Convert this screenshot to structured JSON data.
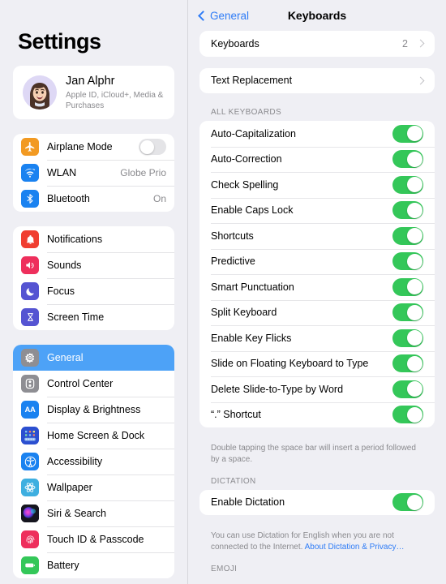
{
  "sidebar": {
    "title": "Settings",
    "account": {
      "name": "Jan Alphr",
      "subtitle": "Apple ID, iCloud+, Media & Purchases",
      "avatar_icon": "memoji-avatar"
    },
    "group1": [
      {
        "label": "Airplane Mode",
        "icon": "airplane-icon",
        "color": "#f29a22",
        "control": "toggle-off"
      },
      {
        "label": "WLAN",
        "icon": "wifi-icon",
        "color": "#1a82f0",
        "value": "Globe Prio"
      },
      {
        "label": "Bluetooth",
        "icon": "bluetooth-icon",
        "color": "#1a82f0",
        "value": "On"
      }
    ],
    "group2": [
      {
        "label": "Notifications",
        "icon": "bell-icon",
        "color": "#f03e30"
      },
      {
        "label": "Sounds",
        "icon": "speaker-icon",
        "color": "#ee2f5c"
      },
      {
        "label": "Focus",
        "icon": "moon-icon",
        "color": "#5554d2"
      },
      {
        "label": "Screen Time",
        "icon": "hourglass-icon",
        "color": "#5554d2"
      }
    ],
    "group3": [
      {
        "label": "General",
        "icon": "gear-icon",
        "color": "#8e8e93",
        "selected": true
      },
      {
        "label": "Control Center",
        "icon": "control-center-icon",
        "color": "#8e8e93"
      },
      {
        "label": "Display & Brightness",
        "icon": "aa-icon",
        "color": "#1a82f0"
      },
      {
        "label": "Home Screen & Dock",
        "icon": "home-screen-icon",
        "color": "#2b4fd0"
      },
      {
        "label": "Accessibility",
        "icon": "accessibility-icon",
        "color": "#1a82f0"
      },
      {
        "label": "Wallpaper",
        "icon": "wallpaper-icon",
        "color": "#3eafe0"
      },
      {
        "label": "Siri & Search",
        "icon": "siri-icon",
        "color": "#1b1b2b"
      },
      {
        "label": "Touch ID & Passcode",
        "icon": "fingerprint-icon",
        "color": "#ee2f5c"
      },
      {
        "label": "Battery",
        "icon": "battery-icon",
        "color": "#34c759"
      }
    ]
  },
  "detail": {
    "back_label": "General",
    "title": "Keyboards",
    "top_rows": [
      {
        "label": "Keyboards",
        "value": "2",
        "chevron": true
      },
      {
        "label": "Text Replacement",
        "value": "",
        "chevron": true
      }
    ],
    "all_keyboards_header": "ALL KEYBOARDS",
    "all_keyboards": [
      {
        "label": "Auto-Capitalization",
        "on": true
      },
      {
        "label": "Auto-Correction",
        "on": true
      },
      {
        "label": "Check Spelling",
        "on": true
      },
      {
        "label": "Enable Caps Lock",
        "on": true
      },
      {
        "label": "Shortcuts",
        "on": true
      },
      {
        "label": "Predictive",
        "on": true
      },
      {
        "label": "Smart Punctuation",
        "on": true
      },
      {
        "label": "Split Keyboard",
        "on": true
      },
      {
        "label": "Enable Key Flicks",
        "on": true
      },
      {
        "label": "Slide on Floating Keyboard to Type",
        "on": true
      },
      {
        "label": "Delete Slide-to-Type by Word",
        "on": true
      },
      {
        "label": "“.” Shortcut",
        "on": true
      }
    ],
    "keyboards_footnote": "Double tapping the space bar will insert a period followed by a space.",
    "dictation_header": "DICTATION",
    "dictation_row": {
      "label": "Enable Dictation",
      "on": true
    },
    "dictation_footnote": "You can use Dictation for English when you are not connected to the Internet. ",
    "dictation_link": "About Dictation & Privacy…",
    "emoji_header": "EMOJI"
  },
  "annotation": {
    "arrow_target": "Predictive toggle",
    "arrow_color": "#e81f14"
  },
  "colors": {
    "accent_blue": "#2f7cf6",
    "toggle_on_green": "#34c759",
    "selected_row_blue": "#4da2f7",
    "page_background": "#efeff4"
  }
}
